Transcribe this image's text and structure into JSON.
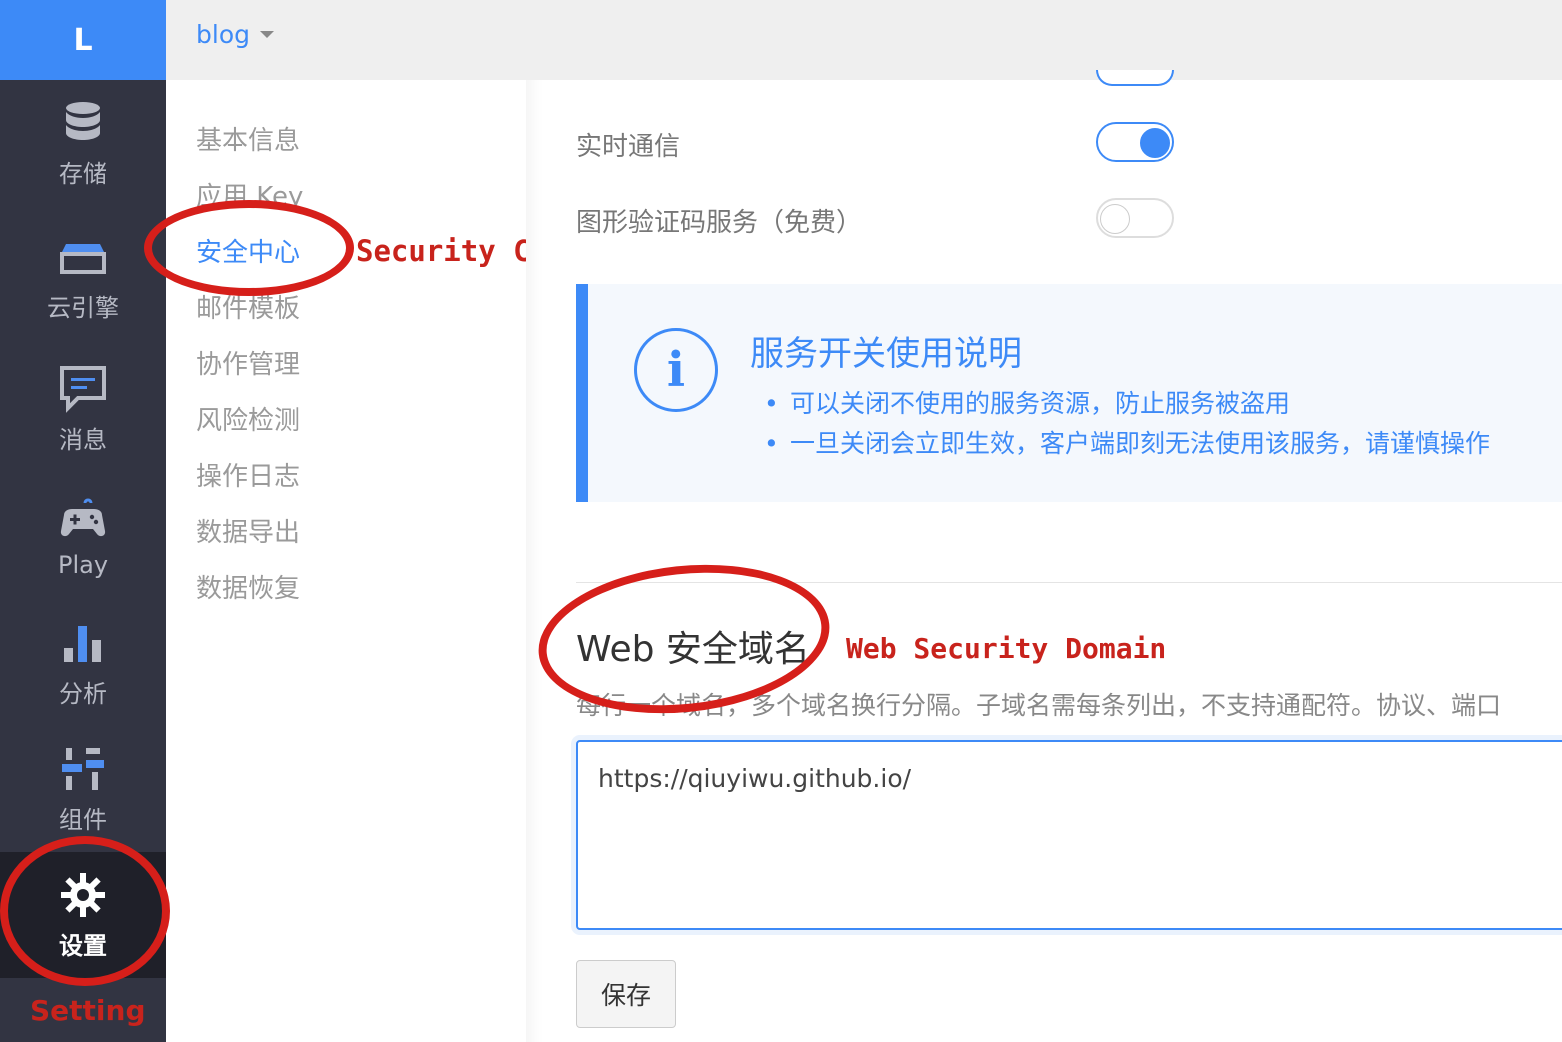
{
  "nav": {
    "logo": "L",
    "items": [
      {
        "label": "存储",
        "icon": "database-icon"
      },
      {
        "label": "云引擎",
        "icon": "cloud-engine-icon"
      },
      {
        "label": "消息",
        "icon": "message-icon"
      },
      {
        "label": "Play",
        "icon": "gamepad-icon"
      },
      {
        "label": "分析",
        "icon": "bar-chart-icon"
      },
      {
        "label": "组件",
        "icon": "components-icon"
      },
      {
        "label": "设置",
        "icon": "gear-icon",
        "active": true
      }
    ],
    "annotation": "Setting"
  },
  "topbar": {
    "app_name": "blog"
  },
  "submenu": {
    "items": [
      "基本信息",
      "应用 Key",
      "安全中心",
      "邮件模板",
      "协作管理",
      "风险检测",
      "操作日志",
      "数据导出",
      "数据恢复"
    ],
    "active": "安全中心",
    "annotation": "Security Center"
  },
  "services": [
    {
      "label": "实时通信",
      "on": true
    },
    {
      "label": "图形验证码服务（免费）",
      "on": false
    }
  ],
  "info": {
    "title": "服务开关使用说明",
    "points": [
      "可以关闭不使用的服务资源，防止服务被盗用",
      "一旦关闭会立即生效，客户端即刻无法使用该服务，请谨慎操作"
    ]
  },
  "web_domain": {
    "title": "Web 安全域名",
    "annotation": "Web Security Domain",
    "hint": "每行一个域名，多个域名换行分隔。子域名需每条列出，不支持通配符。协议、端口",
    "value": "https://qiuyiwu.github.io/",
    "save_label": "保存"
  },
  "colors": {
    "accent": "#3d8af7",
    "nav_bg": "#323442",
    "annotation_red": "#d61f1a"
  }
}
